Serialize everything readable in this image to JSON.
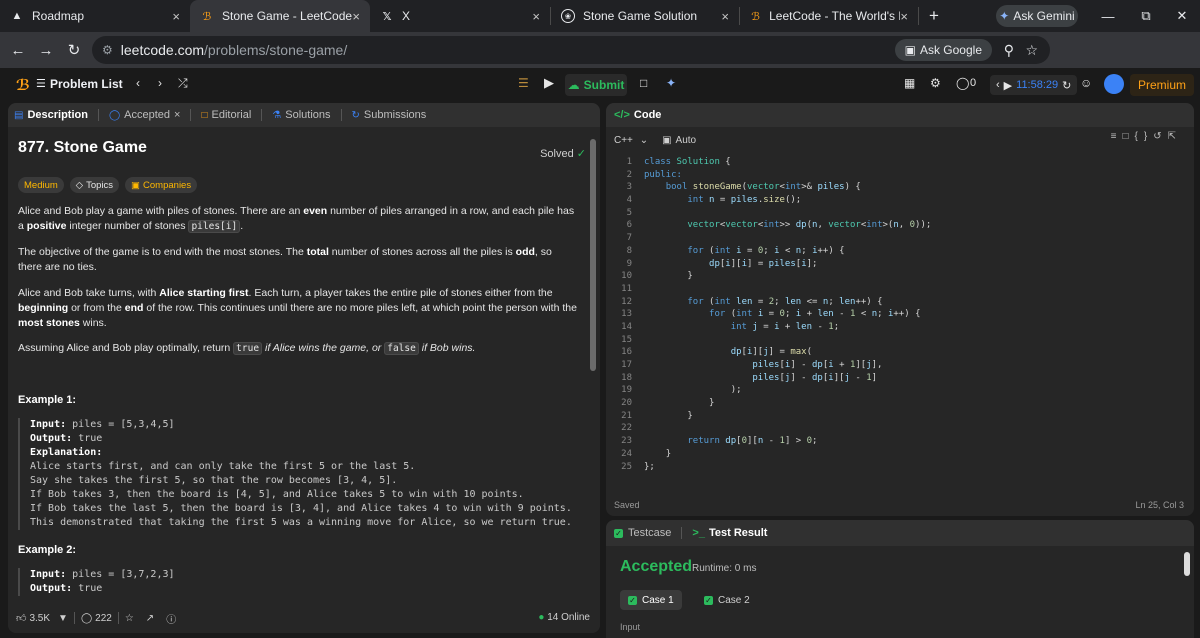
{
  "browser": {
    "tabs": [
      {
        "label": "Roadmap",
        "close": "×"
      },
      {
        "label": "Stone Game - LeetCode",
        "close": "×"
      },
      {
        "label": "X",
        "close": "×"
      },
      {
        "label": "Stone Game Solution",
        "close": "×"
      },
      {
        "label": "LeetCode - The World's Leadin",
        "close": "×"
      }
    ],
    "new_tab": "+",
    "gemini_label": "Ask Gemini",
    "url_domain": "leetcode.com",
    "url_path": "/problems/stone-game/",
    "ask_google": "Ask Google",
    "profile_initial": "E"
  },
  "leetcode": {
    "problem_list": "Problem List",
    "submit": "Submit",
    "notifications": "0",
    "timer": "11:58:29",
    "premium": "Premium"
  },
  "left": {
    "tabs": {
      "description": "Description",
      "accepted": "Accepted",
      "editorial": "Editorial",
      "solutions": "Solutions",
      "submissions": "Submissions"
    },
    "title": "877. Stone Game",
    "solved": "Solved",
    "difficulty": "Medium",
    "topics": "Topics",
    "companies": "Companies",
    "p1a": "Alice and Bob play a game with piles of stones. There are an ",
    "p1b": "even",
    "p1c": " number of piles arranged in a row, and each pile has a ",
    "p1d": "positive",
    "p1e": " integer number of stones ",
    "p1code": "piles[i]",
    "p1f": ".",
    "p2a": "The objective of the game is to end with the most stones. The ",
    "p2b": "total",
    "p2c": " number of stones across all the piles is ",
    "p2d": "odd",
    "p2e": ", so there are no ties.",
    "p3a": "Alice and Bob take turns, with ",
    "p3b": "Alice starting first",
    "p3c": ". Each turn, a player takes the entire pile of stones either from the ",
    "p3d": "beginning",
    "p3e": " or from the ",
    "p3f": "end",
    "p3g": " of the row. This continues until there are no more piles left, at which point the person with the ",
    "p3h": "most stones",
    "p3i": " wins.",
    "p4a": "Assuming Alice and Bob play optimally, return ",
    "p4code1": "true",
    "p4b": " if Alice wins the game, or ",
    "p4code2": "false",
    "p4c": " if Bob wins.",
    "ex1_title": "Example 1:",
    "ex1_input_label": "Input:",
    "ex1_input": "piles = [5,3,4,5]",
    "ex1_output_label": "Output:",
    "ex1_output": "true",
    "ex1_expl_label": "Explanation:",
    "ex1_l1": "Alice starts first, and can only take the first 5 or the last 5.",
    "ex1_l2": "Say she takes the first 5, so that the row becomes [3, 4, 5].",
    "ex1_l3": "If Bob takes 3, then the board is [4, 5], and Alice takes 5 to win with 10 points.",
    "ex1_l4": "If Bob takes the last 5, then the board is [3, 4], and Alice takes 4 to win with 9 points.",
    "ex1_l5": "This demonstrated that taking the first 5 was a winning move for Alice, so we return true.",
    "ex2_title": "Example 2:",
    "ex2_input_label": "Input:",
    "ex2_input": "piles = [3,7,2,3]",
    "ex2_output_label": "Output:",
    "ex2_output": "true",
    "likes": "3.5K",
    "comments": "222",
    "online": "14 Online"
  },
  "code": {
    "header": "Code",
    "language": "C++",
    "auto": "Auto",
    "lines": [
      "class Solution {",
      "public:",
      "    bool stoneGame(vector<int>& piles) {",
      "        int n = piles.size();",
      "",
      "        vector<vector<int>> dp(n, vector<int>(n, 0));",
      "",
      "        for (int i = 0; i < n; i++) {",
      "            dp[i][i] = piles[i];",
      "        }",
      "",
      "        for (int len = 2; len <= n; len++) {",
      "            for (int i = 0; i + len - 1 < n; i++) {",
      "                int j = i + len - 1;",
      "",
      "                dp[i][j] = max(",
      "                    piles[i] - dp[i + 1][j],",
      "                    piles[j] - dp[i][j - 1]",
      "                );",
      "            }",
      "        }",
      "",
      "        return dp[0][n - 1] > 0;",
      "    }",
      "};"
    ],
    "saved": "Saved",
    "cursor": "Ln 25, Col 3"
  },
  "test": {
    "testcase": "Testcase",
    "test_result": "Test Result",
    "status": "Accepted",
    "runtime": "Runtime: 0 ms",
    "case1": "Case 1",
    "case2": "Case 2",
    "input": "Input"
  }
}
